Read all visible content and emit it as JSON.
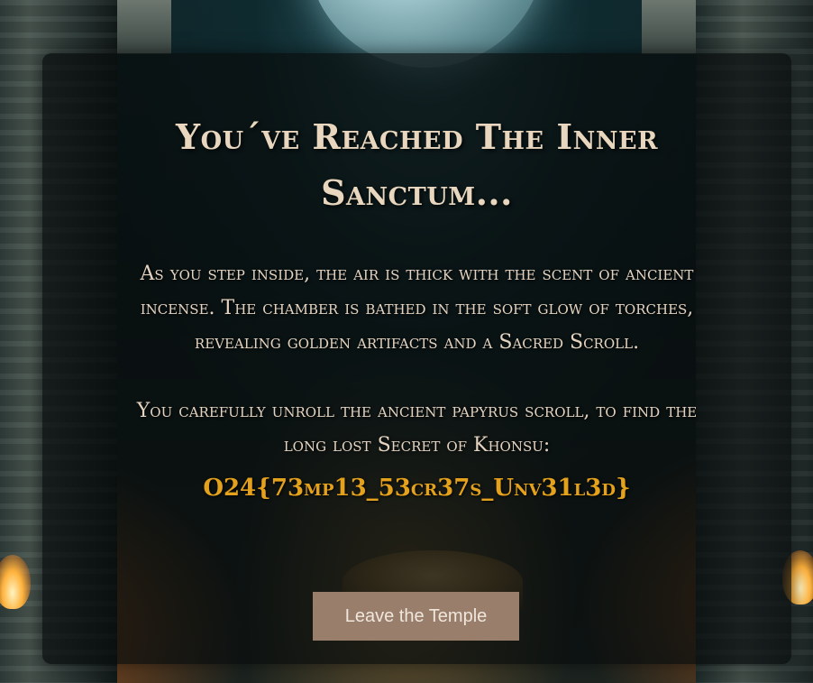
{
  "heading": "You´ve Reached The Inner Sanctum...",
  "paragraphs": [
    "As you step inside, the air is thick with the scent of ancient incense. The chamber is bathed in the soft glow of torches, revealing golden artifacts and a Sacred Scroll.",
    "You carefully unroll the ancient papyrus scroll, to find the long lost Secret of Khonsu:"
  ],
  "flag": "O24{73mp13_53cr37s_Unv31l3d}",
  "button": {
    "label": "Leave the Temple"
  },
  "colors": {
    "flag": "#e4a11b",
    "button_bg": "#9a7e6c",
    "text": "#e3d3c0"
  }
}
